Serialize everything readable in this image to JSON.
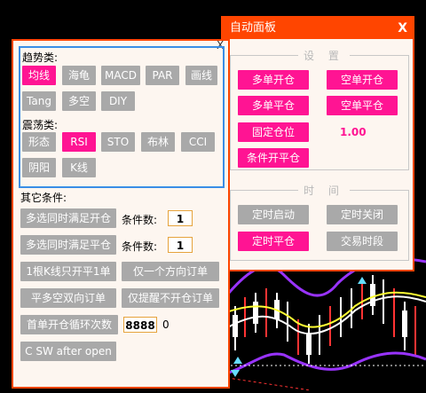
{
  "auto_panel": {
    "title": "自动面板",
    "close": "X",
    "settings_label": "设 置",
    "buttons": {
      "multi_open": "多单开仓",
      "short_open": "空单开仓",
      "multi_close": "多单平仓",
      "short_close": "空单平仓",
      "fixed_position": "固定仓位",
      "fixed_position_value": "1.00",
      "condition_open": "条件开平仓"
    },
    "time_label": "时 间",
    "time_buttons": {
      "timed_start": "定时启动",
      "timed_close_off": "定时关闭",
      "timed_flat": "定时平仓",
      "trading_session": "交易时段"
    }
  },
  "main_panel": {
    "close": "X",
    "trend_label": "趋势类:",
    "trend_items": [
      "均线",
      "海龟",
      "MACD",
      "PAR",
      "画线",
      "Tang",
      "多空",
      "DIY"
    ],
    "oscillator_label": "震荡类:",
    "oscillator_items": [
      "形态",
      "RSI",
      "STO",
      "布林",
      "CCI",
      "阴阳",
      "K线"
    ],
    "other_label": "其它条件:",
    "multi_open_cond": "多选同时满足开仓",
    "multi_close_cond": "多选同时满足平仓",
    "count_label": "条件数:",
    "open_count": "1",
    "close_count": "1",
    "one_bar_one": "1根K线只开平1单",
    "one_direction": "仅一个方向订单",
    "flat_bidir": "平多空双向订单",
    "remind_only": "仅提醒不开仓订单",
    "first_open_loop": "首单开仓循环次数",
    "loop_value": "8888",
    "loop_zero": "0",
    "csw": "C SW after open"
  },
  "colors": {
    "accent": "#ff4500",
    "active": "#ff1493",
    "inactive": "#a9a9a9",
    "selection": "#3a8ee6"
  }
}
